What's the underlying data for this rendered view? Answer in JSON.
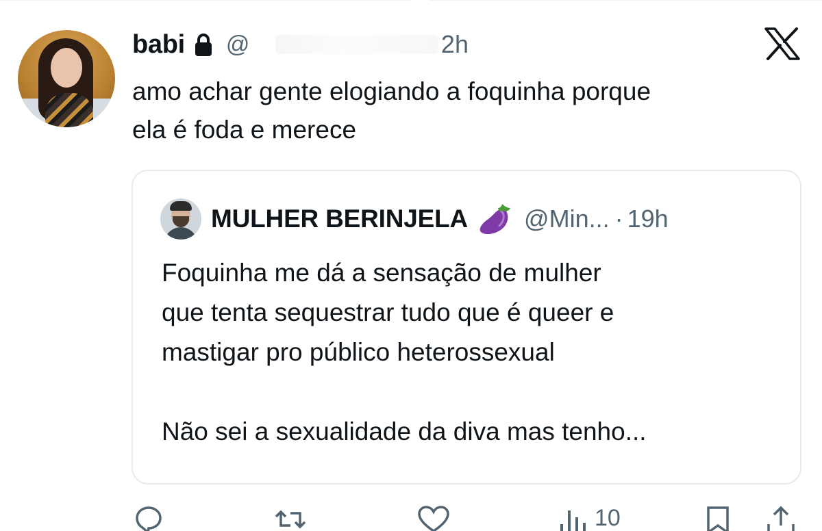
{
  "tweet": {
    "display_name": "babi",
    "handle_prefix": "@",
    "time": "2h",
    "text": "amo achar gente elogiando a foquinha porque\nela é foda e merece"
  },
  "quote": {
    "display_name": "MULHER BERINJELA",
    "handle": "@Min...",
    "separator": "·",
    "time": "19h",
    "text": "Foquinha me dá a sensação de mulher\nque tenta sequestrar tudo que é queer e\nmastigar pro público heterossexual\n\nNão sei a sexualidade da diva mas tenho..."
  },
  "actions": {
    "views_count": "10"
  },
  "icons": {
    "lock": "lock-icon",
    "x_logo": "x-logo-icon",
    "emoji": "eggplant-emoji",
    "reply": "reply-icon",
    "retweet": "retweet-icon",
    "like": "heart-icon",
    "views": "views-icon",
    "bookmark": "bookmark-icon",
    "share": "share-icon"
  },
  "colors": {
    "text": "#0f1419",
    "secondary": "#536471",
    "border": "#e6ebee"
  }
}
